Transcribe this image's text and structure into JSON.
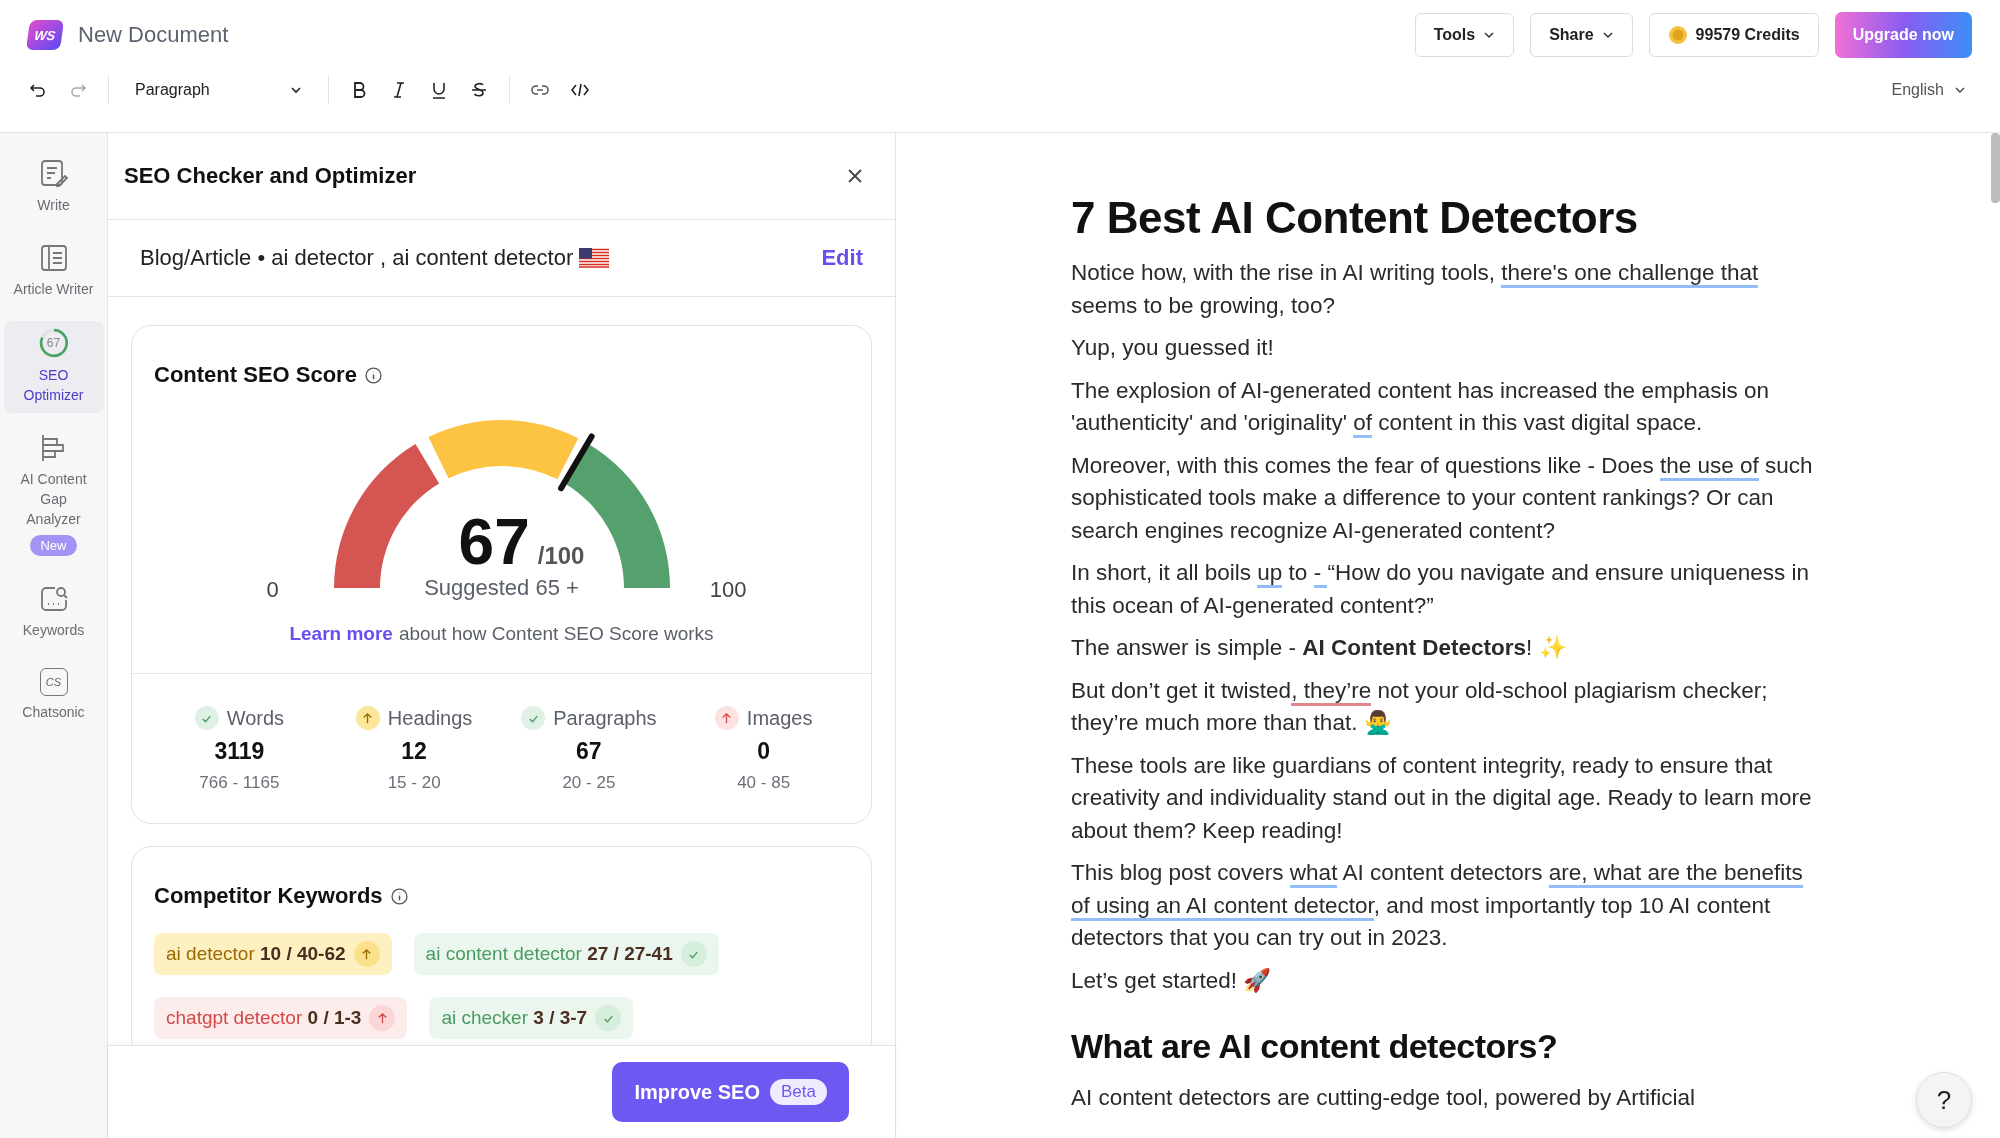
{
  "app": {
    "logo": "WS",
    "document_title": "New Document"
  },
  "toolbar": {
    "block_style": "Paragraph",
    "language": "English"
  },
  "header_buttons": {
    "tools": "Tools",
    "share": "Share",
    "credits": "99579 Credits",
    "upgrade": "Upgrade now"
  },
  "sidebar": {
    "items": [
      {
        "kind": "write",
        "label": "Write",
        "selected": false
      },
      {
        "kind": "article",
        "label": "Article Writer",
        "selected": false
      },
      {
        "kind": "seo",
        "label": "SEO Optimizer",
        "selected": true,
        "ring_label": "67"
      },
      {
        "kind": "gap",
        "label": "AI Content Gap Analyzer",
        "selected": false,
        "badge": "New"
      },
      {
        "kind": "keywords",
        "label": "Keywords",
        "selected": false
      },
      {
        "kind": "chatsonic",
        "label": "Chatsonic",
        "selected": false,
        "icon_text": "CS"
      }
    ]
  },
  "panel": {
    "title": "SEO Checker and Optimizer",
    "summary": "Blog/Article • ai detector , ai content detector",
    "edit": "Edit",
    "score_card": {
      "title": "Content SEO Score",
      "score": "67",
      "out_of": "/100",
      "level": 0.67,
      "min": "0",
      "max": "100",
      "suggested": "Suggested  65 +",
      "learn_more": "Learn more",
      "learn_more_rest": "about how Content SEO Score works"
    },
    "metrics": [
      {
        "label": "Words",
        "kind": "ok",
        "value": "3119",
        "range": "766 - 1165"
      },
      {
        "label": "Headings",
        "kind": "warn",
        "value": "12",
        "range": "15 - 20"
      },
      {
        "label": "Paragraphs",
        "kind": "ok",
        "value": "67",
        "range": "20 - 25"
      },
      {
        "label": "Images",
        "kind": "bad",
        "value": "0",
        "range": "40 - 85"
      }
    ],
    "keywords_card": {
      "title": "Competitor Keywords",
      "chips": [
        {
          "keyword": "ai detector",
          "count": "10 / 40-62",
          "kind": "warn"
        },
        {
          "keyword": "ai content detector",
          "count": "27 / 27-41",
          "kind": "ok"
        },
        {
          "keyword": "chatgpt detector",
          "count": "0 / 1-3",
          "kind": "bad"
        },
        {
          "keyword": "ai checker",
          "count": "3 / 3-7",
          "kind": "ok"
        }
      ]
    },
    "improve_button": "Improve SEO",
    "improve_badge": "Beta"
  },
  "document": {
    "blocks": [
      {
        "kind": "h1",
        "parts": [
          {
            "t": "7 Best AI Content Detectors"
          }
        ]
      },
      {
        "kind": "p",
        "parts": [
          {
            "t": "Notice how, with the rise in AI writing tools, "
          },
          {
            "t": "there's one challenge that",
            "color": "#93bdf7"
          },
          {
            "t": " seems to be growing, too?"
          }
        ]
      },
      {
        "kind": "p",
        "parts": [
          {
            "t": "Yup, you guessed it!"
          }
        ]
      },
      {
        "kind": "p",
        "parts": [
          {
            "t": "The explosion of AI-generated content has increased the emphasis on 'authenticity' and 'originality' "
          },
          {
            "t": "of",
            "color": "#93bdf7"
          },
          {
            "t": " content in this vast digital space."
          }
        ]
      },
      {
        "kind": "p",
        "parts": [
          {
            "t": "Moreover, with this comes the fear of questions like - Does "
          },
          {
            "t": "the use of",
            "color": "#93bdf7"
          },
          {
            "t": " such sophisticated tools make a difference to your content rankings? Or can search engines recognize AI-generated content?"
          }
        ]
      },
      {
        "kind": "p",
        "parts": [
          {
            "t": "In short, it all boils "
          },
          {
            "t": "up",
            "color": "#93bdf7"
          },
          {
            "t": " to "
          },
          {
            "t": "- ",
            "color": "#93bdf7"
          },
          {
            "t": "“How do you navigate and ensure uniqueness in this ocean of AI-generated content?”"
          }
        ]
      },
      {
        "kind": "p",
        "parts": [
          {
            "t": "The answer is simple - "
          },
          {
            "t": "AI Content Detectors",
            "bold": true
          },
          {
            "t": "! ✨"
          }
        ]
      },
      {
        "kind": "p",
        "parts": [
          {
            "t": "But don’t get it twisted"
          },
          {
            "t": ", they’re",
            "color": "#e0868d"
          },
          {
            "t": " not your old-school plagiarism checker; they’re much more than that. 🙅‍♂️"
          }
        ]
      },
      {
        "kind": "p",
        "parts": [
          {
            "t": "These tools are like guardians of content integrity, ready to ensure that creativity and individuality stand out in the digital age. Ready to learn more about them? Keep reading!"
          }
        ]
      },
      {
        "kind": "p",
        "parts": [
          {
            "t": "This blog post covers "
          },
          {
            "t": "what",
            "color": "#93bdf7"
          },
          {
            "t": " AI content detectors "
          },
          {
            "t": "are, what are the benefits of using an AI content detector",
            "color": "#93bdf7"
          },
          {
            "t": ", and most importantly top 10 AI content detectors that you can try out in 2023."
          }
        ]
      },
      {
        "kind": "p",
        "parts": [
          {
            "t": "Let’s get started! 🚀"
          }
        ]
      },
      {
        "kind": "h2",
        "parts": [
          {
            "t": "What are AI content detectors?"
          }
        ]
      },
      {
        "kind": "p",
        "parts": [
          {
            "t": "AI content detectors are cutting-edge tool, powered by Artificial"
          }
        ]
      }
    ]
  },
  "help_button": "?"
}
